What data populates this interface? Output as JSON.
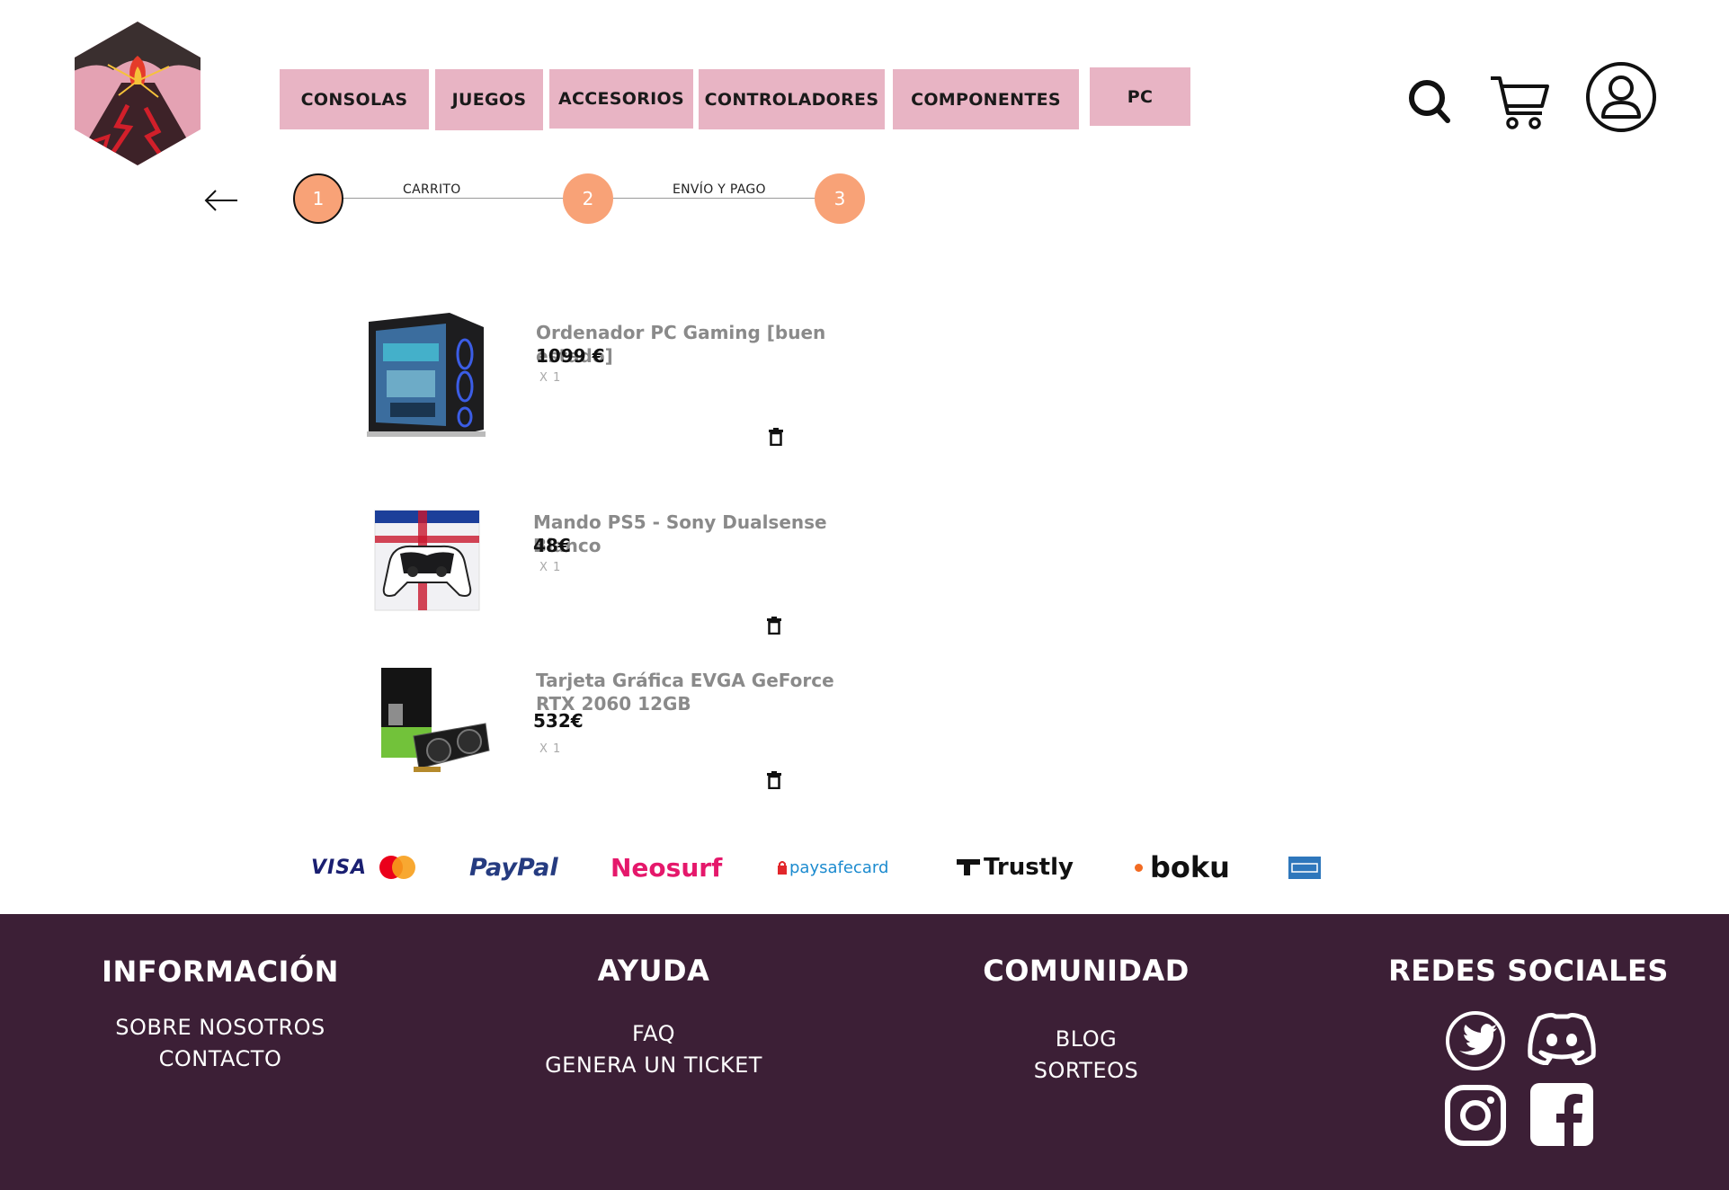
{
  "nav": {
    "items": [
      "CONSOLAS",
      "JUEGOS",
      "ACCESORIOS",
      "CONTROLADORES",
      "COMPONENTES",
      "PC"
    ]
  },
  "header_icons": [
    "search-icon",
    "cart-icon",
    "user-icon"
  ],
  "stepper": {
    "steps": [
      "1",
      "2",
      "3"
    ],
    "labels": [
      "CARRITO",
      "ENVÍO Y PAGO"
    ],
    "active_step": 1,
    "color": "#f8a277"
  },
  "cart": {
    "items": [
      {
        "name": "Ordenador PC Gaming [buen estado]",
        "price": "1099 €",
        "qty": "X 1",
        "image": "pc-tower-image"
      },
      {
        "name": "Mando PS5 - Sony Dualsense Blanco",
        "price": "48€",
        "qty": "X 1",
        "image": "ps5-controller-image"
      },
      {
        "name_line1": "Tarjeta Gráfica EVGA GeForce",
        "name_line2": "RTX 2060 12GB",
        "price": "532€",
        "qty": "X 1",
        "image": "graphics-card-image"
      }
    ]
  },
  "payments": {
    "visa": "VISA",
    "paypal": "PayPal",
    "neosurf": "Neosurf",
    "paysafecard": "paysafecard",
    "trustly": "Trustly",
    "boku": "boku"
  },
  "footer": {
    "informacion": {
      "title": "INFORMACIÓN",
      "links": [
        "SOBRE NOSOTROS",
        "CONTACTO"
      ]
    },
    "ayuda": {
      "title": "AYUDA",
      "links": [
        "FAQ",
        "GENERA UN TICKET"
      ]
    },
    "comunidad": {
      "title": "COMUNIDAD",
      "links": [
        "BLOG",
        "SORTEOS"
      ]
    },
    "redes": {
      "title": "REDES SOCIALES",
      "icons": [
        "twitter-icon",
        "discord-icon",
        "instagram-icon",
        "facebook-icon"
      ]
    }
  },
  "colors": {
    "nav_bg": "#e8b4c4",
    "footer_bg": "#3c1f36",
    "step_accent": "#f8a277"
  }
}
